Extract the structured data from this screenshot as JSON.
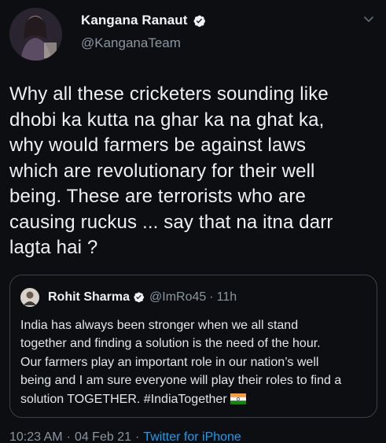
{
  "author": {
    "display_name": "Kangana Ranaut",
    "handle": "@KanganaTeam"
  },
  "tweet": {
    "text": "Why all these cricketers sounding like\ndhobi ka kutta na ghar ka na ghat ka,\nwhy would farmers be against laws\nwhich are revolutionary for their well\nbeing. These are terrorists who are\ncausing ruckus ... say that na itna darr\nlagta hai ?"
  },
  "quoted": {
    "display_name": "Rohit Sharma",
    "handle": "@ImRo45",
    "separator": "·",
    "time": "11h",
    "text": "India has always been stronger when we all stand\ntogether and finding a solution is the need of the hour.\nOur farmers play an important role in our nation’s well\nbeing and I am sure everyone will play their roles to find a\nsolution TOGETHER. #IndiaTogether"
  },
  "footer": {
    "time": "10:23 AM",
    "separator": "·",
    "date": "04 Feb 21",
    "separator2": "·",
    "source": "Twitter for iPhone"
  },
  "colors": {
    "background": "#0c0e11",
    "link": "#1d9bf0",
    "secondary_text": "#8b969f"
  },
  "icons": {
    "verified": "verified-badge-icon",
    "menu": "chevron-down-icon",
    "flag": "india-flag-icon"
  }
}
